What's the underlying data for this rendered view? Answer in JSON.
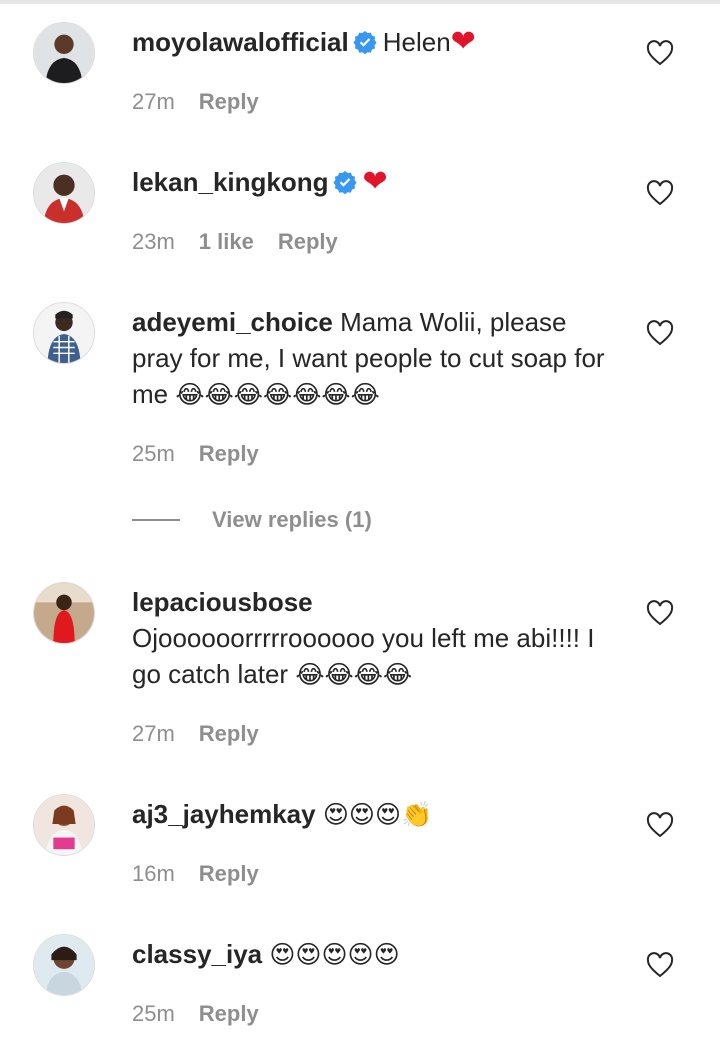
{
  "colors": {
    "text": "#262626",
    "meta": "#8e8e8e",
    "verified": "#3897f0",
    "heart": "#e0152b"
  },
  "comments": [
    {
      "username": "moyolawalofficial",
      "verified": true,
      "text": "Helen",
      "trailing_emoji": "❤",
      "time": "27m",
      "likes": "",
      "reply": "Reply"
    },
    {
      "username": "lekan_kingkong",
      "verified": true,
      "text": "",
      "trailing_emoji": "❤",
      "time": "23m",
      "likes": "1 like",
      "reply": "Reply"
    },
    {
      "username": "adeyemi_choice",
      "verified": false,
      "text": "Mama Wolii, please pray for me, I want people to cut soap for me",
      "trailing_emoji": "😂😂😂😂😂😂😂",
      "time": "25m",
      "likes": "",
      "reply": "Reply",
      "view_replies": "View replies (1)"
    },
    {
      "username": "lepaciousbose",
      "verified": false,
      "text": "Ojoooooorrrrroooooo you left me abi!!!! I go catch later",
      "trailing_emoji": "😂😂😂😂",
      "time": "27m",
      "likes": "",
      "reply": "Reply"
    },
    {
      "username": "aj3_jayhemkay",
      "verified": false,
      "text": "",
      "trailing_emoji": "😍😍😍👏",
      "time": "16m",
      "likes": "",
      "reply": "Reply"
    },
    {
      "username": "classy_iya",
      "verified": false,
      "text": "",
      "trailing_emoji": "😍😍😍😍😍",
      "time": "25m",
      "likes": "",
      "reply": "Reply"
    }
  ],
  "icons": {
    "like": "heart-outline-icon",
    "verified": "verified-badge-icon"
  }
}
